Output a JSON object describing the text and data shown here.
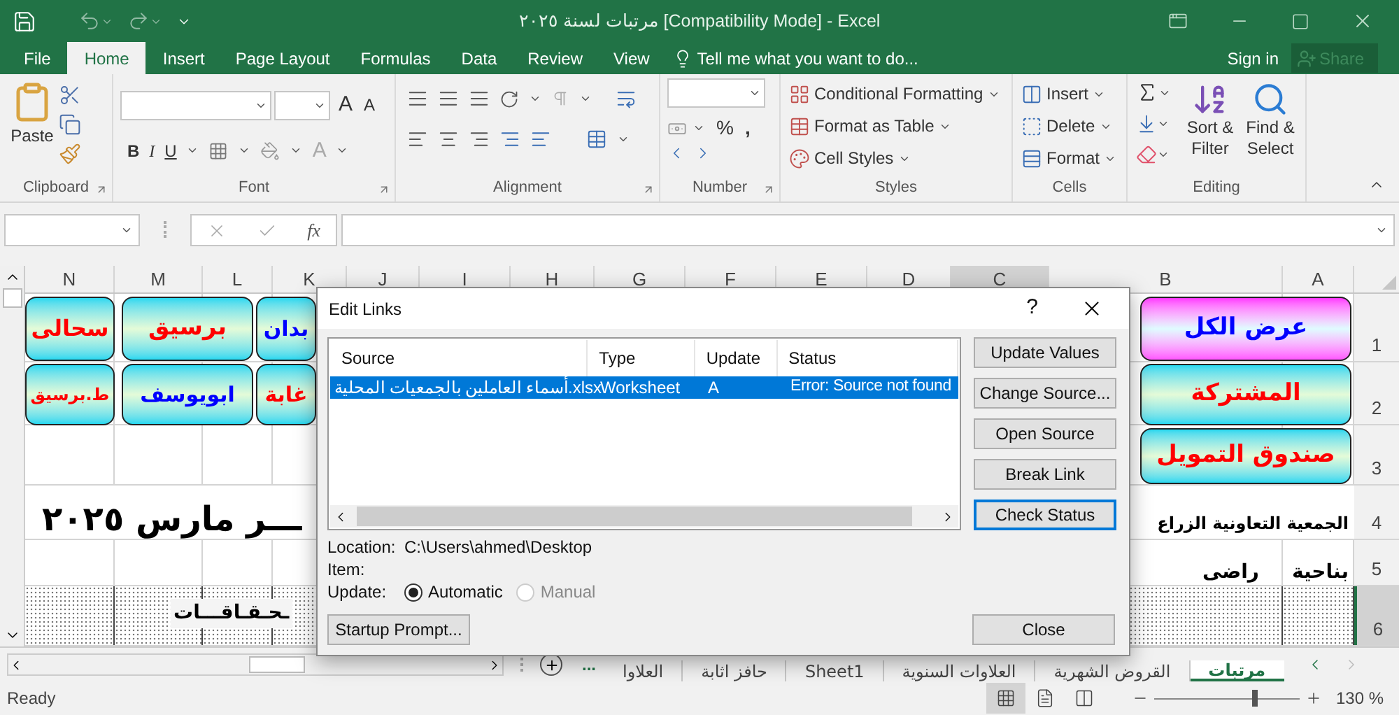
{
  "window": {
    "title": "مرتبات لسنة ٢٠٢٥  [Compatibility Mode] - Excel"
  },
  "ribbon_tabs": [
    {
      "label": "File",
      "selected": false
    },
    {
      "label": "Home",
      "selected": true
    },
    {
      "label": "Insert",
      "selected": false
    },
    {
      "label": "Page Layout",
      "selected": false
    },
    {
      "label": "Formulas",
      "selected": false
    },
    {
      "label": "Data",
      "selected": false
    },
    {
      "label": "Review",
      "selected": false
    },
    {
      "label": "View",
      "selected": false
    }
  ],
  "tell_me": {
    "placeholder": "Tell me what you want to do..."
  },
  "account": {
    "sign_in": "Sign in",
    "share": "Share"
  },
  "ribbon": {
    "clipboard": {
      "paste": "Paste",
      "label": "Clipboard"
    },
    "font": {
      "label": "Font",
      "grow": "A",
      "shrink": "A",
      "bold": "B",
      "italic": "I",
      "underline": "U",
      "font_color": "A"
    },
    "alignment": {
      "label": "Alignment"
    },
    "number": {
      "label": "Number",
      "percent": "%",
      "comma": ","
    },
    "styles": {
      "label": "Styles",
      "items": [
        "Conditional Formatting",
        "Format as Table",
        "Cell Styles"
      ]
    },
    "cells": {
      "label": "Cells",
      "items": [
        "Insert",
        "Delete",
        "Format"
      ]
    },
    "editing": {
      "label": "Editing",
      "sort": [
        "Sort &",
        "Filter"
      ],
      "find": [
        "Find &",
        "Select"
      ]
    }
  },
  "formula_bar": {
    "function": "fx"
  },
  "sheet": {
    "columns": [
      {
        "label": "N",
        "selected": false
      },
      {
        "label": "M",
        "selected": false
      },
      {
        "label": "L",
        "selected": false
      },
      {
        "label": "K",
        "selected": false
      },
      {
        "label": "J",
        "selected": false
      },
      {
        "label": "I",
        "selected": false
      },
      {
        "label": "H",
        "selected": false
      },
      {
        "label": "G",
        "selected": false
      },
      {
        "label": "F",
        "selected": false
      },
      {
        "label": "E",
        "selected": false
      },
      {
        "label": "D",
        "selected": false
      },
      {
        "label": "C",
        "selected": true
      },
      {
        "label": "B",
        "selected": false
      },
      {
        "label": "A",
        "selected": false
      }
    ],
    "rows": [
      {
        "label": "1",
        "selected": false
      },
      {
        "label": "2",
        "selected": false
      },
      {
        "label": "3",
        "selected": false
      },
      {
        "label": "4",
        "selected": false
      },
      {
        "label": "5",
        "selected": false
      },
      {
        "label": "6",
        "selected": true
      }
    ],
    "show_all_shape": {
      "text": "عرض الكل",
      "kind": "pink",
      "color": "#0000ff"
    },
    "shapes": [
      {
        "text": "بدان",
        "kind": "cyan",
        "color": "#0000ff"
      },
      {
        "text": "برسيق",
        "kind": "cyan",
        "color": "#ff0000"
      },
      {
        "text": "سحالى",
        "kind": "cyan",
        "color": "#ff0000"
      },
      {
        "text": "المشتركة",
        "kind": "cyan",
        "color": "#ff0000"
      },
      {
        "text": "غابة",
        "kind": "cyan",
        "color": "#ff0000"
      },
      {
        "text": "ابويوسف",
        "kind": "cyan",
        "color": "#0000ff"
      },
      {
        "text": "ط.برسيق",
        "kind": "cyan",
        "color": "#ff0000"
      },
      {
        "text": "صندوق التمويل",
        "kind": "cyan",
        "color": "#ff0000"
      }
    ],
    "row4_right": "الجمعية التعاونية الزراع",
    "row4_left": "ـــر مارس ٢٠٢٥",
    "row5_a": "بناحية",
    "row5_b": "راضى",
    "row6_text": "ـحـقـاقـــات"
  },
  "dialog": {
    "title": "Edit Links",
    "help": "?",
    "columns": [
      "Source",
      "Type",
      "Update",
      "Status"
    ],
    "links": [
      {
        "source": "أسماء العاملين بالجمعيات المحلية.xlsx",
        "type": "Worksheet",
        "update": "A",
        "status": "Error: Source not found",
        "selected": true
      }
    ],
    "buttons": [
      {
        "label": "Update Values",
        "focused": false
      },
      {
        "label": "Change Source...",
        "focused": false
      },
      {
        "label": "Open Source",
        "focused": false
      },
      {
        "label": "Break Link",
        "focused": false
      },
      {
        "label": "Check Status",
        "focused": true
      }
    ],
    "location_label": "Location:",
    "location": "C:\\Users\\ahmed\\Desktop",
    "item_label": "Item:",
    "update_label": "Update:",
    "update_options": [
      {
        "label": "Automatic",
        "selected": true,
        "disabled": false
      },
      {
        "label": "Manual",
        "selected": false,
        "disabled": true
      }
    ],
    "startup": "Startup Prompt...",
    "close": "Close"
  },
  "sheet_tabs_more": "...",
  "sheet_tabs": [
    {
      "label": "مرتبات",
      "selected": true
    },
    {
      "label": "القروض الشهرية",
      "selected": false
    },
    {
      "label": "العلاوات السنوية",
      "selected": false
    },
    {
      "label": "Sheet1",
      "selected": false
    },
    {
      "label": "حافز اثابة",
      "selected": false
    },
    {
      "label": "العلاوا",
      "selected": false
    }
  ],
  "status_bar": {
    "text": "Ready",
    "views": [
      {
        "kind": "normal",
        "selected": true
      },
      {
        "kind": "page_layout",
        "selected": false
      },
      {
        "kind": "page_break",
        "selected": false
      }
    ],
    "zoom": {
      "level": 0.69,
      "reading": "130 %"
    }
  }
}
